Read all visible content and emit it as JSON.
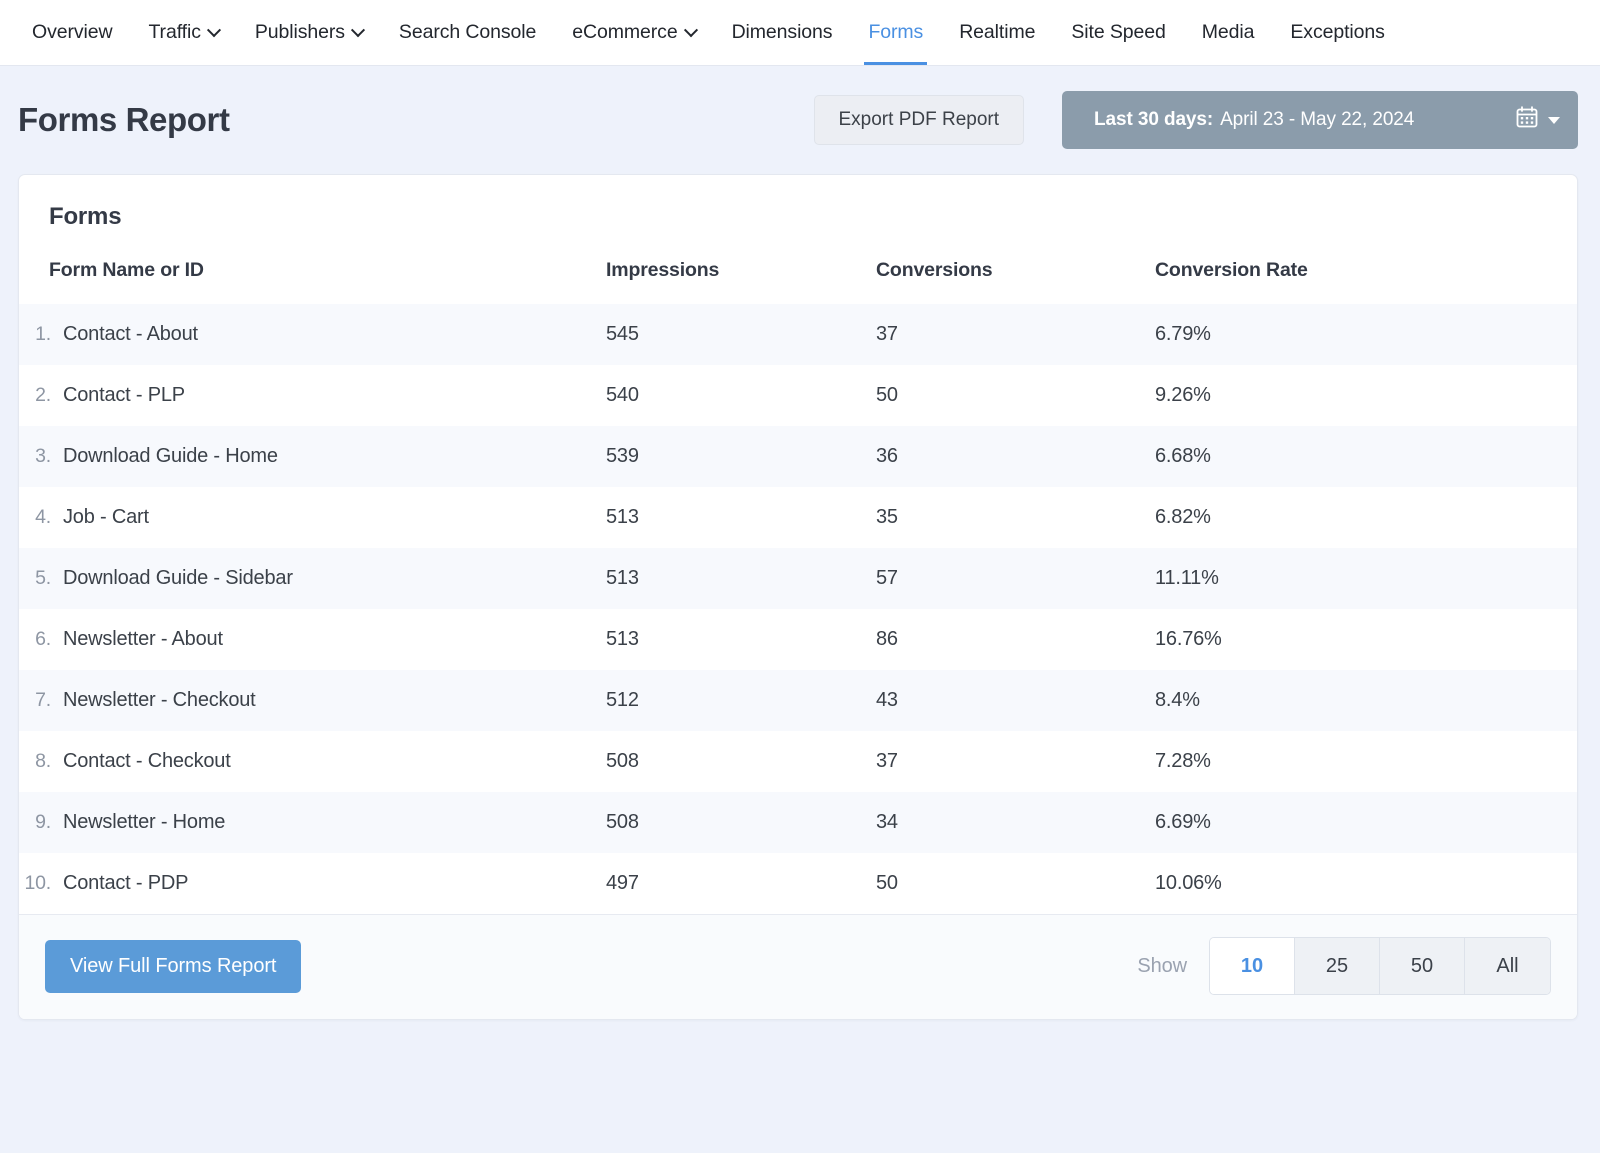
{
  "nav": {
    "items": [
      {
        "label": "Overview",
        "has_caret": false,
        "active": false
      },
      {
        "label": "Traffic",
        "has_caret": true,
        "active": false
      },
      {
        "label": "Publishers",
        "has_caret": true,
        "active": false
      },
      {
        "label": "Search Console",
        "has_caret": false,
        "active": false
      },
      {
        "label": "eCommerce",
        "has_caret": true,
        "active": false
      },
      {
        "label": "Dimensions",
        "has_caret": false,
        "active": false
      },
      {
        "label": "Forms",
        "has_caret": false,
        "active": true
      },
      {
        "label": "Realtime",
        "has_caret": false,
        "active": false
      },
      {
        "label": "Site Speed",
        "has_caret": false,
        "active": false
      },
      {
        "label": "Media",
        "has_caret": false,
        "active": false
      },
      {
        "label": "Exceptions",
        "has_caret": false,
        "active": false
      }
    ],
    "active_accent": "#4a90e2"
  },
  "header": {
    "title": "Forms Report",
    "export_button": "Export PDF Report",
    "date_range": {
      "prefix": "Last 30 days:",
      "value": " April 23 - May 22, 2024",
      "calendar_icon": "calendar-icon",
      "caret_icon": "chevron-down-icon",
      "background": "#8b9cab"
    }
  },
  "card": {
    "title": "Forms",
    "table": {
      "columns": [
        "Form Name or ID",
        "Impressions",
        "Conversions",
        "Conversion Rate"
      ],
      "rows": [
        {
          "rank": "1.",
          "name": "Contact - About",
          "impressions": "545",
          "conversions": "37",
          "rate": "6.79%"
        },
        {
          "rank": "2.",
          "name": "Contact - PLP",
          "impressions": "540",
          "conversions": "50",
          "rate": "9.26%"
        },
        {
          "rank": "3.",
          "name": "Download Guide - Home",
          "impressions": "539",
          "conversions": "36",
          "rate": "6.68%"
        },
        {
          "rank": "4.",
          "name": "Job - Cart",
          "impressions": "513",
          "conversions": "35",
          "rate": "6.82%"
        },
        {
          "rank": "5.",
          "name": "Download Guide - Sidebar",
          "impressions": "513",
          "conversions": "57",
          "rate": "11.11%"
        },
        {
          "rank": "6.",
          "name": "Newsletter - About",
          "impressions": "513",
          "conversions": "86",
          "rate": "16.76%"
        },
        {
          "rank": "7.",
          "name": "Newsletter - Checkout",
          "impressions": "512",
          "conversions": "43",
          "rate": "8.4%"
        },
        {
          "rank": "8.",
          "name": "Contact - Checkout",
          "impressions": "508",
          "conversions": "37",
          "rate": "7.28%"
        },
        {
          "rank": "9.",
          "name": "Newsletter - Home",
          "impressions": "508",
          "conversions": "34",
          "rate": "6.69%"
        },
        {
          "rank": "10.",
          "name": "Contact - PDP",
          "impressions": "497",
          "conversions": "50",
          "rate": "10.06%"
        }
      ]
    },
    "footer": {
      "primary_button": "View Full Forms Report",
      "primary_color": "#5b9bd8",
      "show_label": "Show",
      "page_sizes": [
        {
          "label": "10",
          "active": true
        },
        {
          "label": "25",
          "active": false
        },
        {
          "label": "50",
          "active": false
        },
        {
          "label": "All",
          "active": false
        }
      ]
    }
  }
}
